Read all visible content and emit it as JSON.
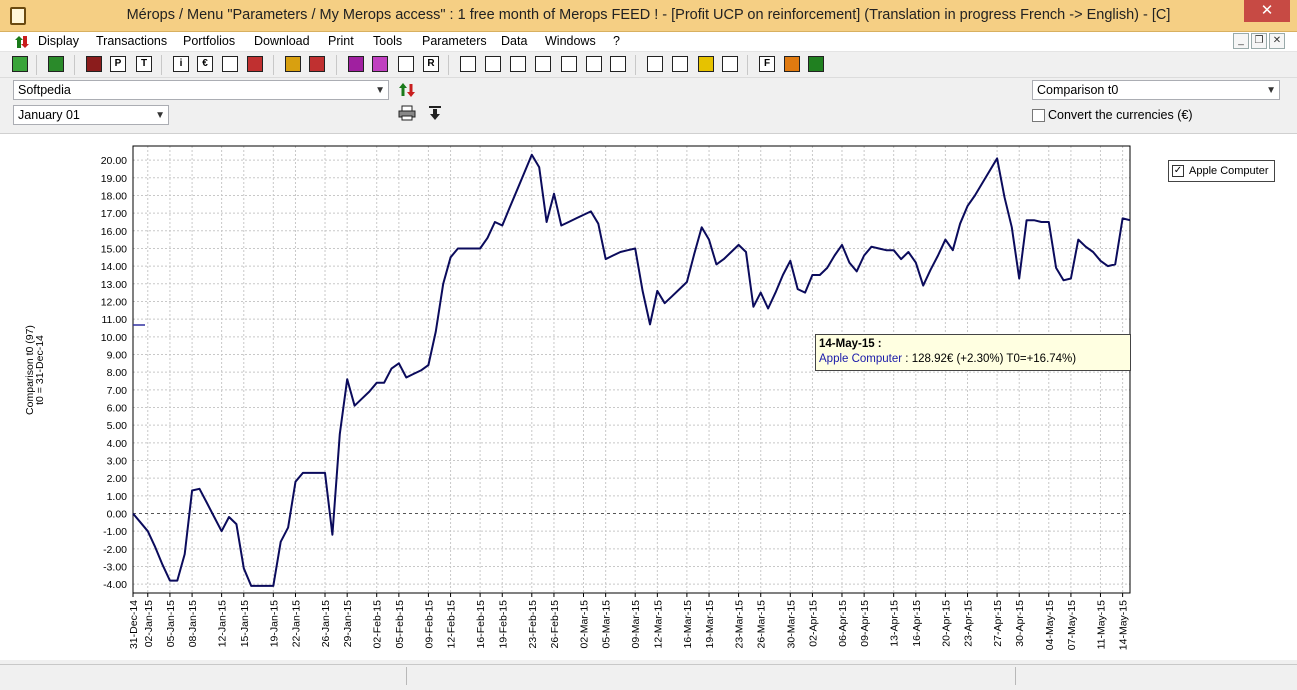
{
  "window": {
    "title": "Mérops / Menu \"Parameters / My Merops access\" : 1 free month of Merops FEED ! - [Profit UCP on reinforcement] (Translation in progress French -> English) - [C]",
    "close_label": "✕"
  },
  "menu": {
    "items": [
      "Display",
      "Transactions",
      "Portfolios",
      "Download",
      "Print",
      "Tools",
      "Parameters",
      "Data",
      "Windows",
      "?"
    ],
    "mdi": [
      "_",
      "❐",
      "✕"
    ]
  },
  "toolbar": {
    "icons": [
      "tag-icon",
      "export-icon",
      "book-icon",
      "p-icon",
      "t-icon",
      "info-icon",
      "euro-icon",
      "info-book-icon",
      "clock-icon",
      "pie-chart-icon",
      "bar-chart-icon",
      "bars-purple-icon",
      "bars-purple2-icon",
      "sort-icon",
      "r-icon",
      "printer-icon",
      "printer2-icon",
      "table-icon",
      "columns-icon",
      "picture-icon",
      "measure-icon",
      "shoe-icon",
      "calc-icon",
      "check-icon",
      "warning-icon",
      "list-icon",
      "f-icon",
      "rss-icon",
      "grid-icon"
    ],
    "glyphs": {
      "p-icon": "P",
      "t-icon": "T",
      "info-icon": "i",
      "euro-icon": "€",
      "r-icon": "R",
      "f-icon": "F"
    }
  },
  "controls": {
    "portfolio_value": "Softpedia",
    "date_value": "January 01",
    "comparison_value": "Comparison t0",
    "convert_label": "Convert the currencies (€)",
    "convert_checked": false
  },
  "legend": {
    "entry": "Apple Computer",
    "checked": true
  },
  "tooltip": {
    "date": "14-May-15 :",
    "series": "Apple Computer",
    "detail": " : 128.92€ (+2.30%) T0=+16.74%)"
  },
  "chart_data": {
    "type": "line",
    "ylabel": [
      "Comparison t0 (97)",
      "t0 = 31-Dec-14"
    ],
    "ylim": [
      -4.5,
      20.8
    ],
    "yticks": [
      -4.0,
      -3.0,
      -2.0,
      -1.0,
      0.0,
      1.0,
      2.0,
      3.0,
      4.0,
      5.0,
      6.0,
      7.0,
      8.0,
      9.0,
      10.0,
      11.0,
      12.0,
      13.0,
      14.0,
      15.0,
      16.0,
      17.0,
      18.0,
      19.0,
      20.0
    ],
    "x_start": "31-Dec-14",
    "x_end": "15-May-15",
    "x_ticks": [
      "31-Dec-14",
      "02-Jan-15",
      "05-Jan-15",
      "08-Jan-15",
      "12-Jan-15",
      "15-Jan-15",
      "19-Jan-15",
      "22-Jan-15",
      "26-Jan-15",
      "29-Jan-15",
      "02-Feb-15",
      "05-Feb-15",
      "09-Feb-15",
      "12-Feb-15",
      "16-Feb-15",
      "19-Feb-15",
      "23-Feb-15",
      "26-Feb-15",
      "02-Mar-15",
      "05-Mar-15",
      "09-Mar-15",
      "12-Mar-15",
      "16-Mar-15",
      "19-Mar-15",
      "23-Mar-15",
      "26-Mar-15",
      "30-Mar-15",
      "02-Apr-15",
      "06-Apr-15",
      "09-Apr-15",
      "13-Apr-15",
      "16-Apr-15",
      "20-Apr-15",
      "23-Apr-15",
      "27-Apr-15",
      "30-Apr-15",
      "04-May-15",
      "07-May-15",
      "11-May-15",
      "14-May-15"
    ],
    "series": [
      {
        "name": "Apple Computer",
        "color": "#0b0b5c",
        "points": [
          [
            "31-Dec-14",
            0.0
          ],
          [
            "01-Jan-15",
            -0.5
          ],
          [
            "02-Jan-15",
            -1.0
          ],
          [
            "03-Jan-15",
            -1.9
          ],
          [
            "04-Jan-15",
            -2.9
          ],
          [
            "05-Jan-15",
            -3.8
          ],
          [
            "06-Jan-15",
            -3.8
          ],
          [
            "07-Jan-15",
            -2.3
          ],
          [
            "08-Jan-15",
            1.3
          ],
          [
            "09-Jan-15",
            1.4
          ],
          [
            "10-Jan-15",
            0.6
          ],
          [
            "11-Jan-15",
            -0.2
          ],
          [
            "12-Jan-15",
            -1.0
          ],
          [
            "13-Jan-15",
            -0.2
          ],
          [
            "14-Jan-15",
            -0.6
          ],
          [
            "15-Jan-15",
            -3.1
          ],
          [
            "16-Jan-15",
            -4.1
          ],
          [
            "17-Jan-15",
            -4.1
          ],
          [
            "18-Jan-15",
            -4.1
          ],
          [
            "19-Jan-15",
            -4.1
          ],
          [
            "20-Jan-15",
            -1.6
          ],
          [
            "21-Jan-15",
            -0.8
          ],
          [
            "22-Jan-15",
            1.8
          ],
          [
            "23-Jan-15",
            2.3
          ],
          [
            "24-Jan-15",
            2.3
          ],
          [
            "25-Jan-15",
            2.3
          ],
          [
            "26-Jan-15",
            2.3
          ],
          [
            "27-Jan-15",
            -1.2
          ],
          [
            "28-Jan-15",
            4.5
          ],
          [
            "29-Jan-15",
            7.6
          ],
          [
            "30-Jan-15",
            6.1
          ],
          [
            "31-Jan-15",
            6.5
          ],
          [
            "01-Feb-15",
            6.9
          ],
          [
            "02-Feb-15",
            7.4
          ],
          [
            "03-Feb-15",
            7.4
          ],
          [
            "04-Feb-15",
            8.2
          ],
          [
            "05-Feb-15",
            8.5
          ],
          [
            "06-Feb-15",
            7.7
          ],
          [
            "07-Feb-15",
            7.9
          ],
          [
            "08-Feb-15",
            8.1
          ],
          [
            "09-Feb-15",
            8.4
          ],
          [
            "10-Feb-15",
            10.3
          ],
          [
            "11-Feb-15",
            13.0
          ],
          [
            "12-Feb-15",
            14.5
          ],
          [
            "13-Feb-15",
            15.0
          ],
          [
            "14-Feb-15",
            15.0
          ],
          [
            "15-Feb-15",
            15.0
          ],
          [
            "16-Feb-15",
            15.0
          ],
          [
            "17-Feb-15",
            15.6
          ],
          [
            "18-Feb-15",
            16.5
          ],
          [
            "19-Feb-15",
            16.3
          ],
          [
            "20-Feb-15",
            17.3
          ],
          [
            "21-Feb-15",
            18.3
          ],
          [
            "22-Feb-15",
            19.3
          ],
          [
            "23-Feb-15",
            20.3
          ],
          [
            "24-Feb-15",
            19.6
          ],
          [
            "25-Feb-15",
            16.5
          ],
          [
            "26-Feb-15",
            18.1
          ],
          [
            "27-Feb-15",
            16.3
          ],
          [
            "28-Feb-15",
            16.5
          ],
          [
            "01-Mar-15",
            16.7
          ],
          [
            "02-Mar-15",
            16.9
          ],
          [
            "03-Mar-15",
            17.1
          ],
          [
            "04-Mar-15",
            16.4
          ],
          [
            "05-Mar-15",
            14.4
          ],
          [
            "06-Mar-15",
            14.6
          ],
          [
            "07-Mar-15",
            14.8
          ],
          [
            "08-Mar-15",
            14.9
          ],
          [
            "09-Mar-15",
            15.0
          ],
          [
            "10-Mar-15",
            12.6
          ],
          [
            "11-Mar-15",
            10.7
          ],
          [
            "12-Mar-15",
            12.6
          ],
          [
            "13-Mar-15",
            11.9
          ],
          [
            "14-Mar-15",
            12.3
          ],
          [
            "15-Mar-15",
            12.7
          ],
          [
            "16-Mar-15",
            13.1
          ],
          [
            "17-Mar-15",
            14.7
          ],
          [
            "18-Mar-15",
            16.2
          ],
          [
            "19-Mar-15",
            15.5
          ],
          [
            "20-Mar-15",
            14.1
          ],
          [
            "21-Mar-15",
            14.4
          ],
          [
            "22-Mar-15",
            14.8
          ],
          [
            "23-Mar-15",
            15.2
          ],
          [
            "24-Mar-15",
            14.8
          ],
          [
            "25-Mar-15",
            11.7
          ],
          [
            "26-Mar-15",
            12.5
          ],
          [
            "27-Mar-15",
            11.6
          ],
          [
            "28-Mar-15",
            12.5
          ],
          [
            "29-Mar-15",
            13.5
          ],
          [
            "30-Mar-15",
            14.3
          ],
          [
            "31-Mar-15",
            12.7
          ],
          [
            "01-Apr-15",
            12.5
          ],
          [
            "02-Apr-15",
            13.5
          ],
          [
            "03-Apr-15",
            13.5
          ],
          [
            "04-Apr-15",
            13.9
          ],
          [
            "05-Apr-15",
            14.6
          ],
          [
            "06-Apr-15",
            15.2
          ],
          [
            "07-Apr-15",
            14.2
          ],
          [
            "08-Apr-15",
            13.7
          ],
          [
            "09-Apr-15",
            14.6
          ],
          [
            "10-Apr-15",
            15.1
          ],
          [
            "11-Apr-15",
            15.0
          ],
          [
            "12-Apr-15",
            14.9
          ],
          [
            "13-Apr-15",
            14.9
          ],
          [
            "14-Apr-15",
            14.4
          ],
          [
            "15-Apr-15",
            14.8
          ],
          [
            "16-Apr-15",
            14.2
          ],
          [
            "17-Apr-15",
            12.9
          ],
          [
            "18-Apr-15",
            13.8
          ],
          [
            "19-Apr-15",
            14.6
          ],
          [
            "20-Apr-15",
            15.5
          ],
          [
            "21-Apr-15",
            14.9
          ],
          [
            "22-Apr-15",
            16.4
          ],
          [
            "23-Apr-15",
            17.4
          ],
          [
            "24-Apr-15",
            18.0
          ],
          [
            "25-Apr-15",
            18.7
          ],
          [
            "26-Apr-15",
            19.4
          ],
          [
            "27-Apr-15",
            20.1
          ],
          [
            "28-Apr-15",
            17.9
          ],
          [
            "29-Apr-15",
            16.2
          ],
          [
            "30-Apr-15",
            13.3
          ],
          [
            "01-May-15",
            16.6
          ],
          [
            "02-May-15",
            16.6
          ],
          [
            "03-May-15",
            16.5
          ],
          [
            "04-May-15",
            16.5
          ],
          [
            "05-May-15",
            13.9
          ],
          [
            "06-May-15",
            13.2
          ],
          [
            "07-May-15",
            13.3
          ],
          [
            "08-May-15",
            15.5
          ],
          [
            "09-May-15",
            15.1
          ],
          [
            "10-May-15",
            14.8
          ],
          [
            "11-May-15",
            14.3
          ],
          [
            "12-May-15",
            14.0
          ],
          [
            "13-May-15",
            14.1
          ],
          [
            "14-May-15",
            16.7
          ],
          [
            "15-May-15",
            16.6
          ]
        ]
      }
    ]
  }
}
